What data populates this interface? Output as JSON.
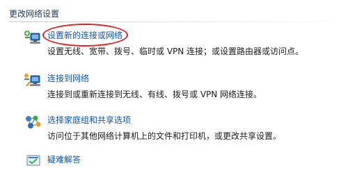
{
  "section": {
    "title": "更改网络设置"
  },
  "tasks": [
    {
      "link": "设置新的连接或网络",
      "description": "设置无线、宽带、拨号、临时或 VPN 连接；或设置路由器或访问点。",
      "icon": "new-connection-icon"
    },
    {
      "link": "连接到网络",
      "description": "连接到或重新连接到无线、有线、拨号或 VPN 网络连接。",
      "icon": "connect-network-icon"
    },
    {
      "link": "选择家庭组和共享选项",
      "description": "访问位于其他网络计算机上的文件和打印机，或更改共享设置。",
      "icon": "homegroup-icon"
    },
    {
      "link": "疑难解答",
      "description": "",
      "icon": "troubleshoot-icon"
    }
  ],
  "colors": {
    "link": "#0b55b5",
    "section_title": "#1e395b",
    "annotation": "#e02020"
  }
}
